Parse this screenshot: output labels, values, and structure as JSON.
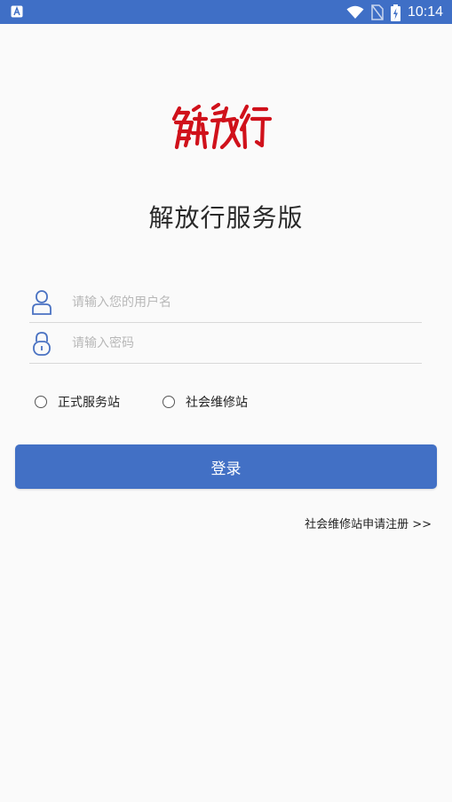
{
  "status_bar": {
    "time": "10:14"
  },
  "logo": {
    "text": "解放行"
  },
  "app_title": "解放行服务版",
  "form": {
    "username_placeholder": "请输入您的用户名",
    "password_placeholder": "请输入密码"
  },
  "station_type": {
    "options": [
      "正式服务站",
      "社会维修站"
    ],
    "selected": null
  },
  "login_button": "登录",
  "register_link": "社会维修站申请注册 >>",
  "colors": {
    "status_bar": "#3f6fc6",
    "primary": "#4270c5",
    "logo_red": "#d0111b",
    "icon_blue": "#4a72c2"
  }
}
